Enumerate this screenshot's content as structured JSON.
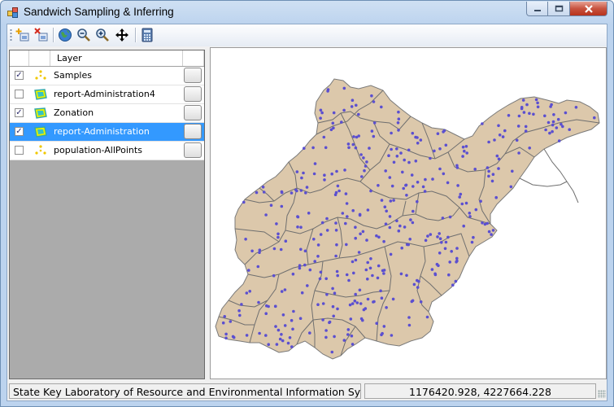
{
  "window": {
    "title": "Sandwich Sampling & Inferring"
  },
  "toolbar": {
    "buttons": [
      "add-layer-icon",
      "remove-layer-icon",
      "full-extent-icon",
      "zoom-out-icon",
      "zoom-in-icon",
      "pan-icon",
      "calculator-icon"
    ]
  },
  "layers": {
    "header": "Layer",
    "items": [
      {
        "name": "Samples",
        "checked": true,
        "type": "point"
      },
      {
        "name": "report-Administration4",
        "checked": false,
        "type": "polygon"
      },
      {
        "name": "Zonation",
        "checked": true,
        "type": "polygon"
      },
      {
        "name": "report-Administration",
        "checked": true,
        "type": "polygon",
        "selected": true
      },
      {
        "name": "population-AllPoints",
        "checked": false,
        "type": "point"
      }
    ]
  },
  "status": {
    "organization": "State Key Laboratory of Resource and Environmental Information System",
    "coordinates": "1176420.928, 4227664.228"
  },
  "colors": {
    "selection": "#3399ff",
    "polygon_fill": "#dcc8ab",
    "boundary": "#6f6f6f",
    "sample_point": "#5b4fd0"
  }
}
